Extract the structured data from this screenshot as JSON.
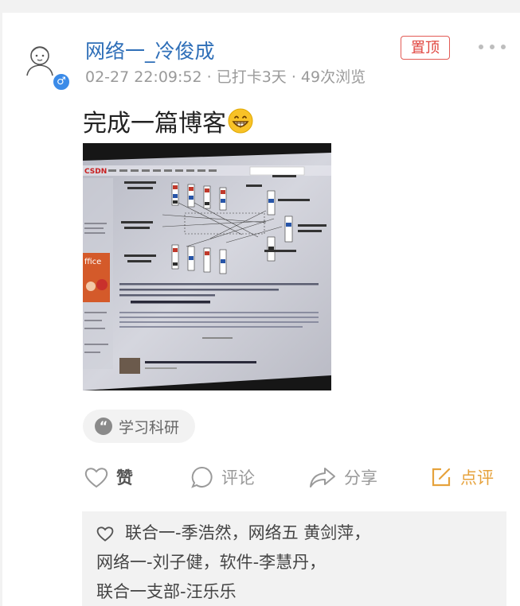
{
  "post": {
    "username": "网络一_冷俊成",
    "meta": "02-27 22:09:52 · 已打卡3天 · 49次浏览",
    "pin_label": "置顶",
    "text": "完成一篇博客",
    "tag": "学习科研"
  },
  "actions": {
    "like": "赞",
    "comment": "评论",
    "share": "分享",
    "review": "点评"
  },
  "likes": {
    "line1": "联合一-季浩然，网络五 黄剑萍，",
    "line2": "网络一-刘子健，软件-李慧丹，",
    "line3": "联合一支部-汪乐乐"
  },
  "colors": {
    "username": "#2f6fb8",
    "pin": "#e0453f",
    "review": "#e6a23c",
    "gender": "#3b8be8"
  }
}
